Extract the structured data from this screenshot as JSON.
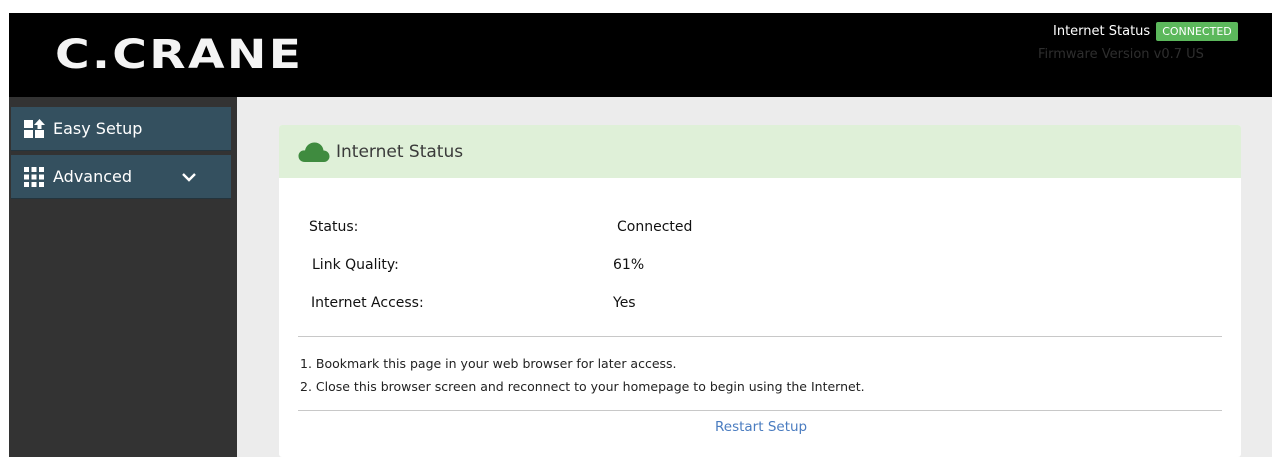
{
  "header": {
    "logo": "C.CRANE",
    "status_label": "Internet Status",
    "status_badge": "CONNECTED",
    "firmware": "Firmware Version v0.7 US"
  },
  "sidebar": {
    "items": [
      {
        "label": "Easy Setup",
        "icon": "easy-setup-icon"
      },
      {
        "label": "Advanced",
        "icon": "grid-icon",
        "expand_icon": "chevron-down-icon"
      }
    ]
  },
  "card": {
    "title": "Internet Status",
    "icon": "cloud-icon",
    "rows": [
      {
        "label": "Status:",
        "value": "Connected"
      },
      {
        "label": "Link Quality:",
        "value": "61%"
      },
      {
        "label": "Internet Access:",
        "value": "Yes"
      }
    ],
    "notes": [
      "1. Bookmark this page in your web browser for later access.",
      "2. Close this browser screen and reconnect to your homepage to begin using the Internet."
    ],
    "restart_link": "Restart Setup"
  },
  "colors": {
    "header_bg": "#000000",
    "sidebar_bg": "#333333",
    "sidebar_item_bg": "#34505f",
    "card_header_bg": "#dff0d8",
    "badge_green": "#5cb85c",
    "link_blue": "#4a7cc0"
  }
}
